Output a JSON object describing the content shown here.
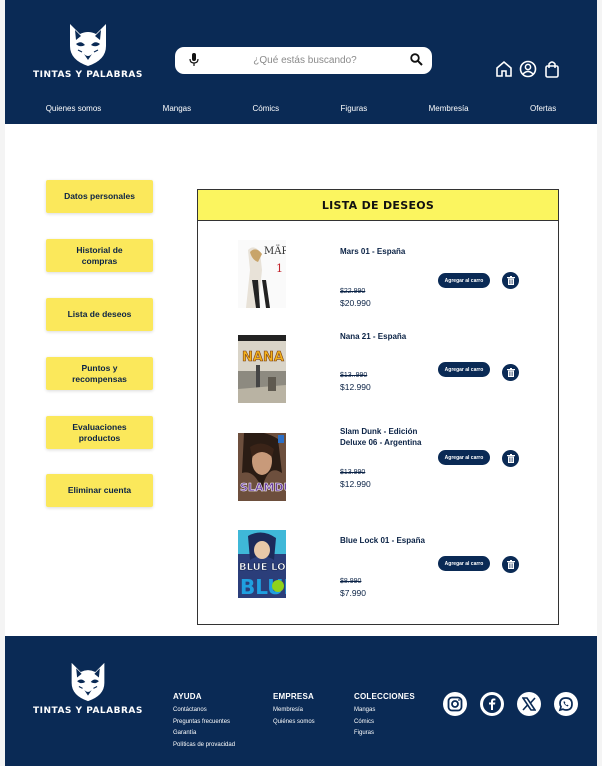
{
  "brand": {
    "name": "TINTAS Y PALABRAS"
  },
  "search": {
    "placeholder": "¿Qué estás buscando?"
  },
  "nav": [
    "Quienes somos",
    "Mangas",
    "Cómics",
    "Figuras",
    "Membresía",
    "Ofertas"
  ],
  "sidebar": [
    "Datos personales",
    "Historial de compras",
    "Lista de deseos",
    "Puntos y recompensas",
    "Evaluaciones productos",
    "Eliminar cuenta"
  ],
  "wishlist": {
    "title": "LISTA DE DESEOS",
    "add_to_cart_label": "Agregar al carro",
    "items": [
      {
        "name": "Mars 01 - España",
        "old_price": "$22.990",
        "price": "$20.990"
      },
      {
        "name": "Nana 21 - España",
        "old_price": "$13..990",
        "price": "$12.990"
      },
      {
        "name": "Slam Dunk - Edición Deluxe 06 - Argentina",
        "old_price": "$13.990",
        "price": "$12.990"
      },
      {
        "name": "Blue Lock 01 - España",
        "old_price": "$8.990",
        "price": "$7.990"
      }
    ]
  },
  "footer": {
    "ayuda": {
      "title": "AYUDA",
      "links": [
        "Contáctanos",
        "Preguntas frecuentes",
        "Garantía",
        "Políticas de provacidad"
      ]
    },
    "empresa": {
      "title": "EMPRESA",
      "links": [
        "Membresía",
        "Quiénes somos"
      ]
    },
    "colecciones": {
      "title": "COLECCIONES",
      "links": [
        "Mangas",
        "Cómics",
        "Figuras"
      ]
    },
    "social_icons": [
      "instagram-icon",
      "facebook-icon",
      "x-icon",
      "whatsapp-icon"
    ]
  },
  "colors": {
    "navy": "#0a2a55",
    "yellow": "#fbe85b",
    "title_yellow": "#fbf55f"
  }
}
